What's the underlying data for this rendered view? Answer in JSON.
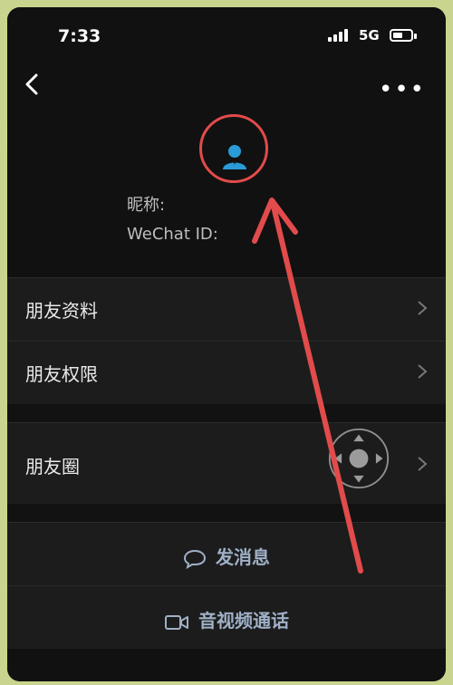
{
  "status_bar": {
    "time": "7:33",
    "network": "5G"
  },
  "profile": {
    "nickname_label": "昵称:",
    "wechat_id_label": "WeChat ID:"
  },
  "menu": [
    {
      "label": "朋友资料"
    },
    {
      "label": "朋友权限"
    },
    {
      "label": "朋友圈"
    }
  ],
  "actions": {
    "message": "发消息",
    "call": "音视频通话"
  },
  "icons": {
    "back": "chevron-left-icon",
    "more": "more-dots-icon",
    "avatar": "user-avatar-icon",
    "chevron": "chevron-right-icon",
    "message": "chat-bubble-icon",
    "call": "video-camera-icon",
    "assistive_touch": "dpad-icon"
  },
  "colors": {
    "highlight_ring": "#e24b4b",
    "arrow": "#e24b4b",
    "accent": "#9fb0c7",
    "avatar": "#2a9bd6"
  }
}
